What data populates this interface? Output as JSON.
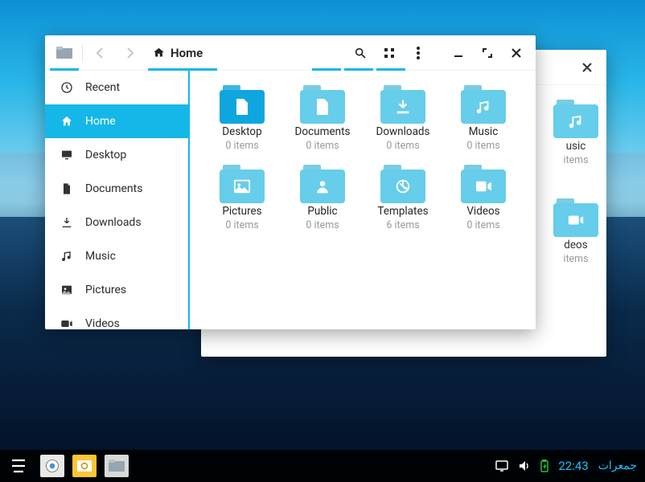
{
  "colors": {
    "accent": "#14b7e8"
  },
  "location": {
    "label": "Home"
  },
  "toolbar": {
    "back": "navigate-back",
    "forward": "navigate-forward",
    "search": "search",
    "view": "icon-view",
    "menu": "menu",
    "min": "minimize",
    "max": "maximize",
    "close": "close"
  },
  "sidebar": {
    "items": [
      {
        "label": "Recent",
        "icon": "clock"
      },
      {
        "label": "Home",
        "icon": "home"
      },
      {
        "label": "Desktop",
        "icon": "desktop"
      },
      {
        "label": "Documents",
        "icon": "document"
      },
      {
        "label": "Downloads",
        "icon": "download"
      },
      {
        "label": "Music",
        "icon": "music"
      },
      {
        "label": "Pictures",
        "icon": "pictures"
      },
      {
        "label": "Videos",
        "icon": "videos"
      }
    ],
    "active_index": 1
  },
  "folders": [
    {
      "name": "Desktop",
      "count": "0 items",
      "icon": "doc",
      "selected": true
    },
    {
      "name": "Documents",
      "count": "0 items",
      "icon": "doc"
    },
    {
      "name": "Downloads",
      "count": "0 items",
      "icon": "download"
    },
    {
      "name": "Music",
      "count": "0 items",
      "icon": "music"
    },
    {
      "name": "Pictures",
      "count": "0 items",
      "icon": "pictures"
    },
    {
      "name": "Public",
      "count": "0 items",
      "icon": "public"
    },
    {
      "name": "Templates",
      "count": "6 items",
      "icon": "templates"
    },
    {
      "name": "Videos",
      "count": "0 items",
      "icon": "videos"
    }
  ],
  "back_window": {
    "close": "close",
    "partials": [
      {
        "name": "usic",
        "count": "items",
        "icon": "music"
      },
      {
        "name": "deos",
        "count": "items",
        "icon": "videos"
      }
    ]
  },
  "taskbar": {
    "apps": [
      {
        "name": "logo"
      },
      {
        "name": "browser"
      },
      {
        "name": "mail"
      },
      {
        "name": "files"
      }
    ],
    "tray": {
      "display": "display",
      "volume": "volume",
      "battery": "battery"
    },
    "time": "22:43",
    "date": "جمعرات"
  }
}
